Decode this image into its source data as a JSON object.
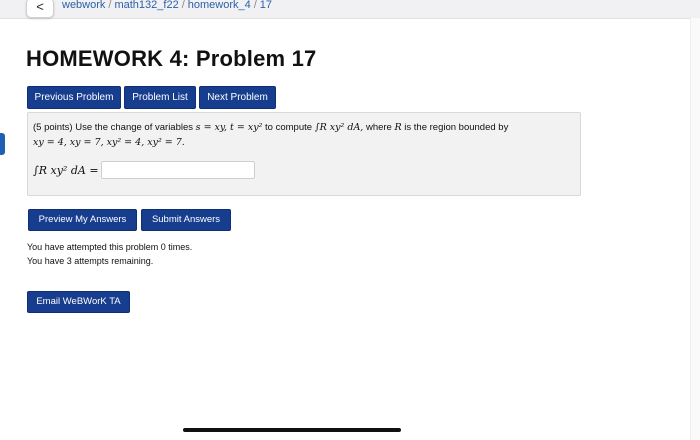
{
  "breadcrumb": {
    "back_glyph": "<",
    "items": [
      "webwork",
      "math132_f22",
      "homework_4",
      "17"
    ],
    "separator": "/"
  },
  "page": {
    "title": "HOMEWORK 4: Problem 17"
  },
  "nav": {
    "previous": "Previous Problem",
    "list": "Problem List",
    "next": "Next Problem"
  },
  "problem": {
    "points": "(5 points)",
    "intro": "Use the change of variables",
    "subst": "s = xy, t = xy²",
    "to_compute": "to compute",
    "integral": "∫R xy² dA,",
    "where": "where",
    "region_var": "R",
    "region_text": "is the region bounded by",
    "bounds": "xy = 4, xy = 7, xy² = 4, xy² = 7.",
    "answer_label": "∫R xy² dA =",
    "answer_value": ""
  },
  "actions": {
    "preview": "Preview My Answers",
    "submit": "Submit Answers"
  },
  "attempts": {
    "made": "You have attempted this problem 0 times.",
    "remaining": "You have 3 attempts remaining."
  },
  "email": {
    "label": "Email WeBWorK TA"
  },
  "colors": {
    "button": "#173d8f",
    "link": "#2a5fa8",
    "panel": "#f2f2f2"
  }
}
